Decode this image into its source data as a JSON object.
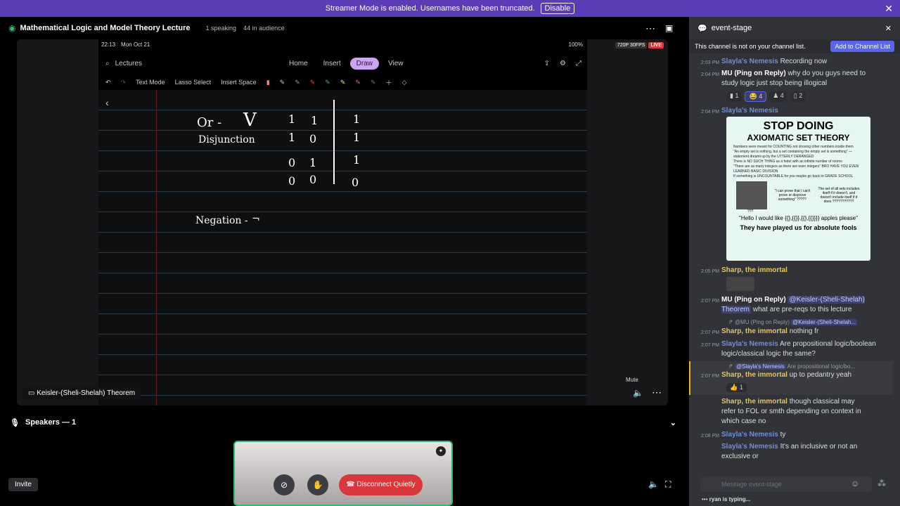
{
  "banner": {
    "text": "Streamer Mode is enabled. Usernames have been truncated.",
    "button": "Disable"
  },
  "stage": {
    "title": "Mathematical Logic and Model Theory Lecture",
    "speaking": "1 speaking",
    "audience": "44 in audience"
  },
  "stream": {
    "clock": "22:13",
    "date": "Mon Oct 21",
    "battery": "100%",
    "quality": "720P 30FPS",
    "live": "LIVE",
    "search": "Lectures",
    "tabs": [
      "Home",
      "Insert",
      "Draw",
      "View"
    ],
    "tools": [
      "Text Mode",
      "Lasso Select",
      "Insert Space"
    ],
    "notes": {
      "or": "Or -",
      "vee": "V",
      "disjunction": "Disjunction",
      "negation": "Negation -",
      "neg_symbol": "¬",
      "truth_rows": [
        [
          "1",
          "1",
          "1"
        ],
        [
          "1",
          "0",
          "1"
        ],
        [
          "0",
          "1",
          "1"
        ],
        [
          "0",
          "0",
          "0"
        ]
      ]
    }
  },
  "presenter": "Keisler-(Sheli-Shelah) Theorem",
  "mute_tip": "Mute",
  "speakers": "Speakers — 1",
  "controls": {
    "invite": "Invite",
    "disconnect": "Disconnect Quietly"
  },
  "chat": {
    "channel": "event-stage",
    "notice": "This channel is not on your channel list.",
    "add": "Add to Channel List",
    "placeholder": "Message event-stage",
    "typing": "ryan is typing...",
    "messages": [
      {
        "ts": "2:03 PM",
        "author": "Slayla's Nemesis",
        "text": "Recording now"
      },
      {
        "ts": "2:04 PM",
        "author": "MU (Ping on Reply)",
        "text": "why do you guys need to study logic just stop being illogical",
        "reactions": [
          "1",
          "4",
          "4",
          "2"
        ]
      },
      {
        "ts": "2:04 PM",
        "author": "Slayla's Nemesis",
        "text": ""
      },
      {
        "ts": "2:05 PM",
        "author": "Sharp, the immortal",
        "text": ""
      },
      {
        "ts": "2:07 PM",
        "author": "MU (Ping on Reply)",
        "mention": "@Keisler-(Sheli-Shelah) Theorem",
        "text": "what are pre-reqs to this lecture"
      },
      {
        "reply": "@MU (Ping on Reply)",
        "reply_mention": "@Keisler-(Sheli-Shelah..."
      },
      {
        "ts": "2:07 PM",
        "author": "Sharp, the immortal",
        "text": "nothing fr"
      },
      {
        "ts": "2:07 PM",
        "author": "Slayla's Nemesis",
        "text": "Are propositional logic/boolean logic/classical logic the same?"
      },
      {
        "reply": "@Slayla's Nemesis",
        "reply_text": "Are propositional logic/bo..."
      },
      {
        "ts": "2:07 PM",
        "author": "Sharp, the immortal",
        "text": "up to pedantry yeah",
        "reactions": [
          "1"
        ]
      },
      {
        "author": "Sharp, the immortal",
        "text": "though classical may refer to FOL or smth depending on context in which case no"
      },
      {
        "ts": "2:08 PM",
        "author": "Slayla's Nemesis",
        "text": "ty"
      },
      {
        "author": "Slayla's Nemesis",
        "text": "It's an inclusive or not an exclusive or"
      }
    ],
    "meme": {
      "title1": "STOP DOING",
      "title2": "AXIOMATIC SET THEORY",
      "bullets": [
        "Numbers were meant for COUNTING not shoving other numbers inside them",
        "\"An empty set is nothing, but a set containing the empty set is something\" — statement dreamt up by the UTTERLY DERANGED",
        "There is NO SUCH THING as a hotel with an infinite number of rooms",
        "\"There are as many integers as there are even integers\" BRO HAVE YOU EVEN LEARNED BASIC DIVISION",
        "If something is UNCOUNTABLE for you maybe go back to GRADE SCHOOL"
      ],
      "caption1": "\"I can prove that I can't prove or disprove something\" ?????",
      "caption2": "The set of all sets includes itself if it doesn't, and doesn't include itself if it does ???????????",
      "marks": "???",
      "quote": "\"Hello I would like {{},{{}},{{},{{}}}} apples please\"",
      "footer": "They have played us for absolute fools"
    }
  }
}
